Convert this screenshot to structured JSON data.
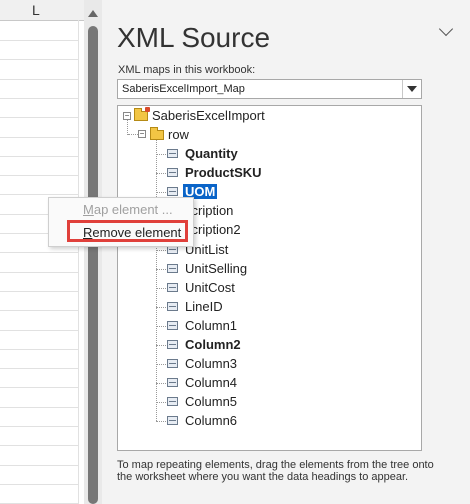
{
  "sheet": {
    "column_letter": "L"
  },
  "pane": {
    "title": "XML Source",
    "maps_label": "XML maps in this workbook:",
    "selected_map": "SaberisExcelImport_Map",
    "footer": "To map repeating elements, drag the elements from the tree onto the worksheet where you want the data headings to appear."
  },
  "tree": {
    "root": "SaberisExcelImport",
    "row": "row",
    "children": [
      {
        "label": "Quantity",
        "bold": true
      },
      {
        "label": "ProductSKU",
        "bold": true
      },
      {
        "label": "UOM",
        "bold": true,
        "selected": true
      },
      {
        "label": "Description",
        "visible": "scription"
      },
      {
        "label": "Description2",
        "visible": "scription2"
      },
      {
        "label": "UnitList"
      },
      {
        "label": "UnitSelling"
      },
      {
        "label": "UnitCost"
      },
      {
        "label": "LineID"
      },
      {
        "label": "Column1"
      },
      {
        "label": "Column2",
        "bold": true
      },
      {
        "label": "Column3"
      },
      {
        "label": "Column4"
      },
      {
        "label": "Column5"
      },
      {
        "label": "Column6"
      }
    ]
  },
  "context_menu": {
    "map_element_prefix": "",
    "map_element_underlined": "M",
    "map_element_rest": "ap element ...",
    "remove_element_underlined": "R",
    "remove_element_rest": "emove element"
  }
}
